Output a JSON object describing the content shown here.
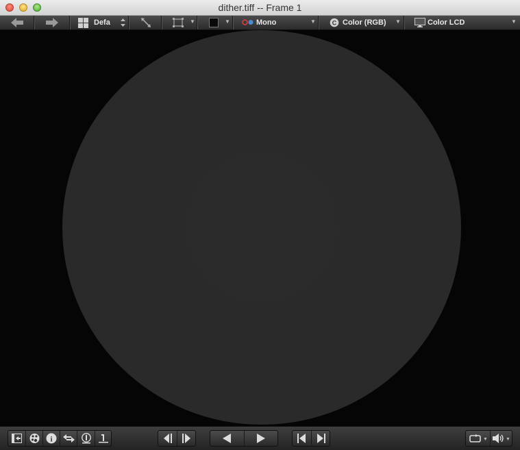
{
  "window": {
    "title": "dither.tiff -- Frame 1"
  },
  "toolbar": {
    "layout_label": "Defa",
    "channel_label": "Mono",
    "colorspace_label": "Color (RGB)",
    "display_label": "Color LCD"
  },
  "icons": {
    "back": "arrow-left-icon",
    "forward": "arrow-right-icon",
    "layout": "grid-icon",
    "fit": "fit-icon",
    "crop": "crop-icon",
    "background": "background-swatch-icon",
    "channels": "channels-icon",
    "colorspace": "color-icon",
    "display": "monitor-icon"
  },
  "colors": {
    "canvas_bg": "#050505",
    "image_disc": "#2a2a2a",
    "toolbar_text": "#e8e8e8",
    "channel_red": "#d8403a",
    "channel_blue": "#4a8ad8"
  }
}
